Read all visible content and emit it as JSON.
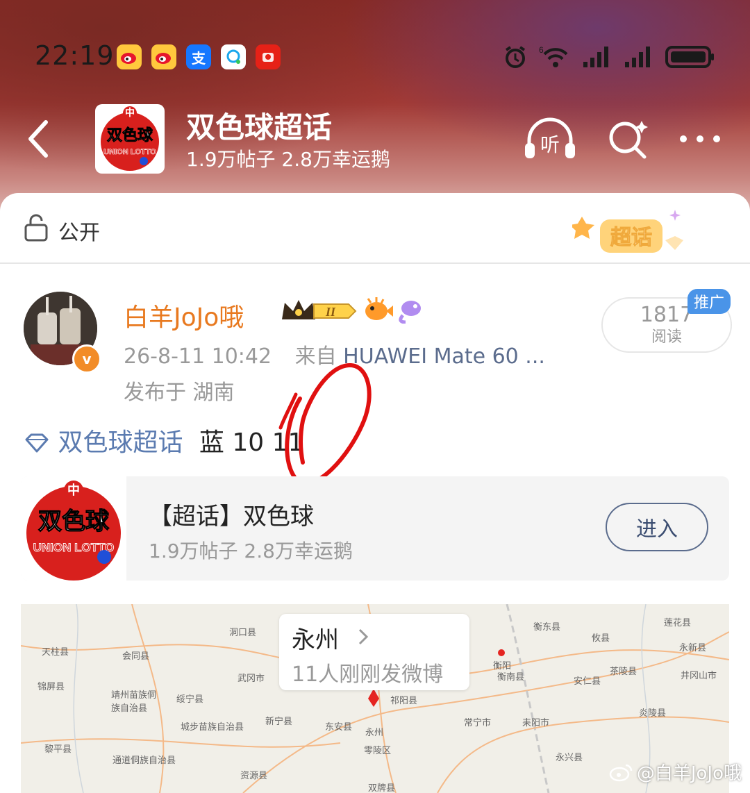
{
  "status_bar": {
    "time": "22:19",
    "signal_sup": "6"
  },
  "header": {
    "title": "双色球超话",
    "subtitle": "1.9万帖子 2.8万幸运鹅",
    "listen_label": "听",
    "logo_text_top": "双色球",
    "logo_text_bottom": "UNION LOTTO"
  },
  "privacy": {
    "label": "公开",
    "badge": "超话"
  },
  "post": {
    "username": "白羊JoJo哦",
    "level": "II",
    "verified_mark": "v",
    "meta_time": "26-8-11 10:42",
    "meta_from": "来自",
    "meta_device": "HUAWEI Mate 60 ...",
    "location": "发布于 湖南",
    "reads_count": "1817",
    "reads_label": "阅读",
    "promo": "推广",
    "topic_tag": "双色球超话",
    "text": "蓝 10 11"
  },
  "topic_card": {
    "title": "【超话】双色球",
    "stats": "1.9万帖子 2.8万幸运鹅",
    "enter_button": "进入"
  },
  "map": {
    "city": "永州",
    "count_text": "11人刚刚发微博",
    "labels": [
      {
        "text": "洞口县",
        "k": "a"
      },
      {
        "text": "天柱县",
        "k": "b"
      },
      {
        "text": "会同县",
        "k": "c"
      },
      {
        "text": "武冈市",
        "k": "d"
      },
      {
        "text": "锦屏县",
        "k": "e"
      },
      {
        "text": "靖州苗族侗族自治县",
        "k": "f"
      },
      {
        "text": "绥宁县",
        "k": "g"
      },
      {
        "text": "城步苗族自治县",
        "k": "h"
      },
      {
        "text": "新宁县",
        "k": "i"
      },
      {
        "text": "东安县",
        "k": "j"
      },
      {
        "text": "永州",
        "k": "k"
      },
      {
        "text": "零陵区",
        "k": "l"
      },
      {
        "text": "祁阳县",
        "k": "m"
      },
      {
        "text": "常宁市",
        "k": "n"
      },
      {
        "text": "耒阳市",
        "k": "o"
      },
      {
        "text": "衡阳",
        "k": "p"
      },
      {
        "text": "衡南县",
        "k": "q"
      },
      {
        "text": "衡东县",
        "k": "r"
      },
      {
        "text": "攸县",
        "k": "s"
      },
      {
        "text": "安仁县",
        "k": "t"
      },
      {
        "text": "茶陵县",
        "k": "u"
      },
      {
        "text": "炎陵县",
        "k": "v"
      },
      {
        "text": "永兴县",
        "k": "w"
      },
      {
        "text": "莲花县",
        "k": "x"
      },
      {
        "text": "永新县",
        "k": "y"
      },
      {
        "text": "井冈山市",
        "k": "z"
      },
      {
        "text": "资源县",
        "k": "aa"
      },
      {
        "text": "黎平县",
        "k": "bb"
      },
      {
        "text": "通道侗族自治县",
        "k": "cc"
      },
      {
        "text": "双牌县",
        "k": "dd"
      }
    ]
  },
  "watermark": "@白羊JoJo哦",
  "colors": {
    "username": "#e8791f",
    "topic": "#5b7bb0",
    "accent_red": "#e52521",
    "promo_blue": "#4a94e8"
  }
}
